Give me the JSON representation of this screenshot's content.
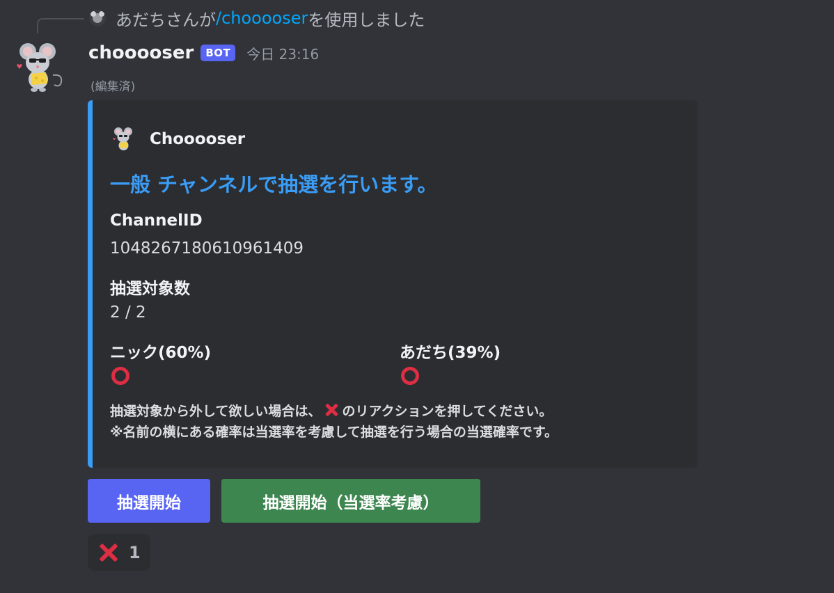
{
  "reply": {
    "user": "あだちさんが",
    "command": "/chooooser",
    "suffix": "を使用しました"
  },
  "message": {
    "username": "chooooser",
    "badge": "BOT",
    "timestamp": "今日 23:16",
    "edited": "(編集済)"
  },
  "embed": {
    "author": "Chooooser",
    "title": "一般 チャンネルで抽選を行います。",
    "accent_color": "#3a9cf4",
    "fields": [
      {
        "name": "ChannelID",
        "value": "1048267180610961409"
      },
      {
        "name": "抽選対象数",
        "value": "2 / 2"
      },
      {
        "name": "ニック(60%)",
        "value_icon": "red-circle-icon"
      },
      {
        "name": "あだち(39%)",
        "value_icon": "red-circle-icon"
      }
    ],
    "description_line1_before": "抽選対象から外して欲しい場合は、",
    "description_line1_after": "のリアクションを押してください。",
    "description_line2": "※名前の横にある確率は当選率を考慮して抽選を行う場合の当選確率です。"
  },
  "buttons": {
    "start": "抽選開始",
    "start_weighted": "抽選開始（当選率考慮）"
  },
  "reaction": {
    "icon": "cross-mark-icon",
    "count": "1"
  },
  "colors": {
    "background": "#313338",
    "embed_bg": "#2b2d31",
    "blurple": "#5865f2",
    "green": "#3e8650",
    "red": "#dd2e44",
    "link": "#00a8fc"
  }
}
